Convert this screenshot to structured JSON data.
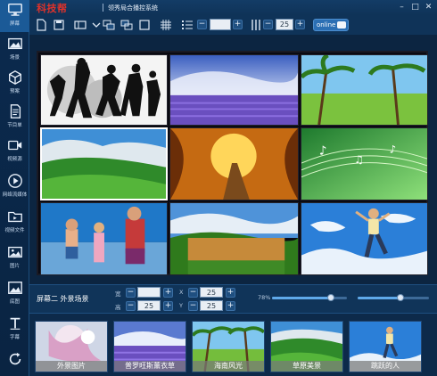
{
  "app": {
    "brand": "科技帮",
    "subtitle": "领秀局合播控系统"
  },
  "sidebar": {
    "items": [
      {
        "label": "屏幕",
        "icon": "monitor-icon"
      },
      {
        "label": "场景",
        "icon": "scene-icon"
      },
      {
        "label": "预案",
        "icon": "cube-icon"
      },
      {
        "label": "节目单",
        "icon": "document-icon"
      },
      {
        "label": "视频源",
        "icon": "video-camera-icon"
      },
      {
        "label": "网络流媒体",
        "icon": "play-circle-icon"
      },
      {
        "label": "视频文件",
        "icon": "folder-icon"
      },
      {
        "label": "图片",
        "icon": "image-icon"
      },
      {
        "label": "底图",
        "icon": "picture-icon"
      },
      {
        "label": "字幕",
        "icon": "text-icon"
      },
      {
        "label": "",
        "icon": "refresh-icon"
      }
    ]
  },
  "toolbar": {
    "field_a": "",
    "field_b": "25",
    "online_label": "online"
  },
  "panel": {
    "title": "屏幕二  外景场景",
    "w_label": "宽",
    "h_label": "高",
    "x_label": "X",
    "y_label": "Y",
    "w_value": "",
    "h_value": "25",
    "x_value": "25",
    "y_value": "25",
    "opacity_label": "78%",
    "opacity": 0.78,
    "volume": 0.6
  },
  "thumbnails": [
    {
      "caption": "外景图片"
    },
    {
      "caption": "普罗旺斯薰衣草"
    },
    {
      "caption": "海南风光"
    },
    {
      "caption": "草原美景"
    },
    {
      "caption": "跳跃的人"
    }
  ],
  "colors": {
    "accent": "#2b6fb4",
    "brand": "#e0322a",
    "background": "#0d2a4a"
  }
}
